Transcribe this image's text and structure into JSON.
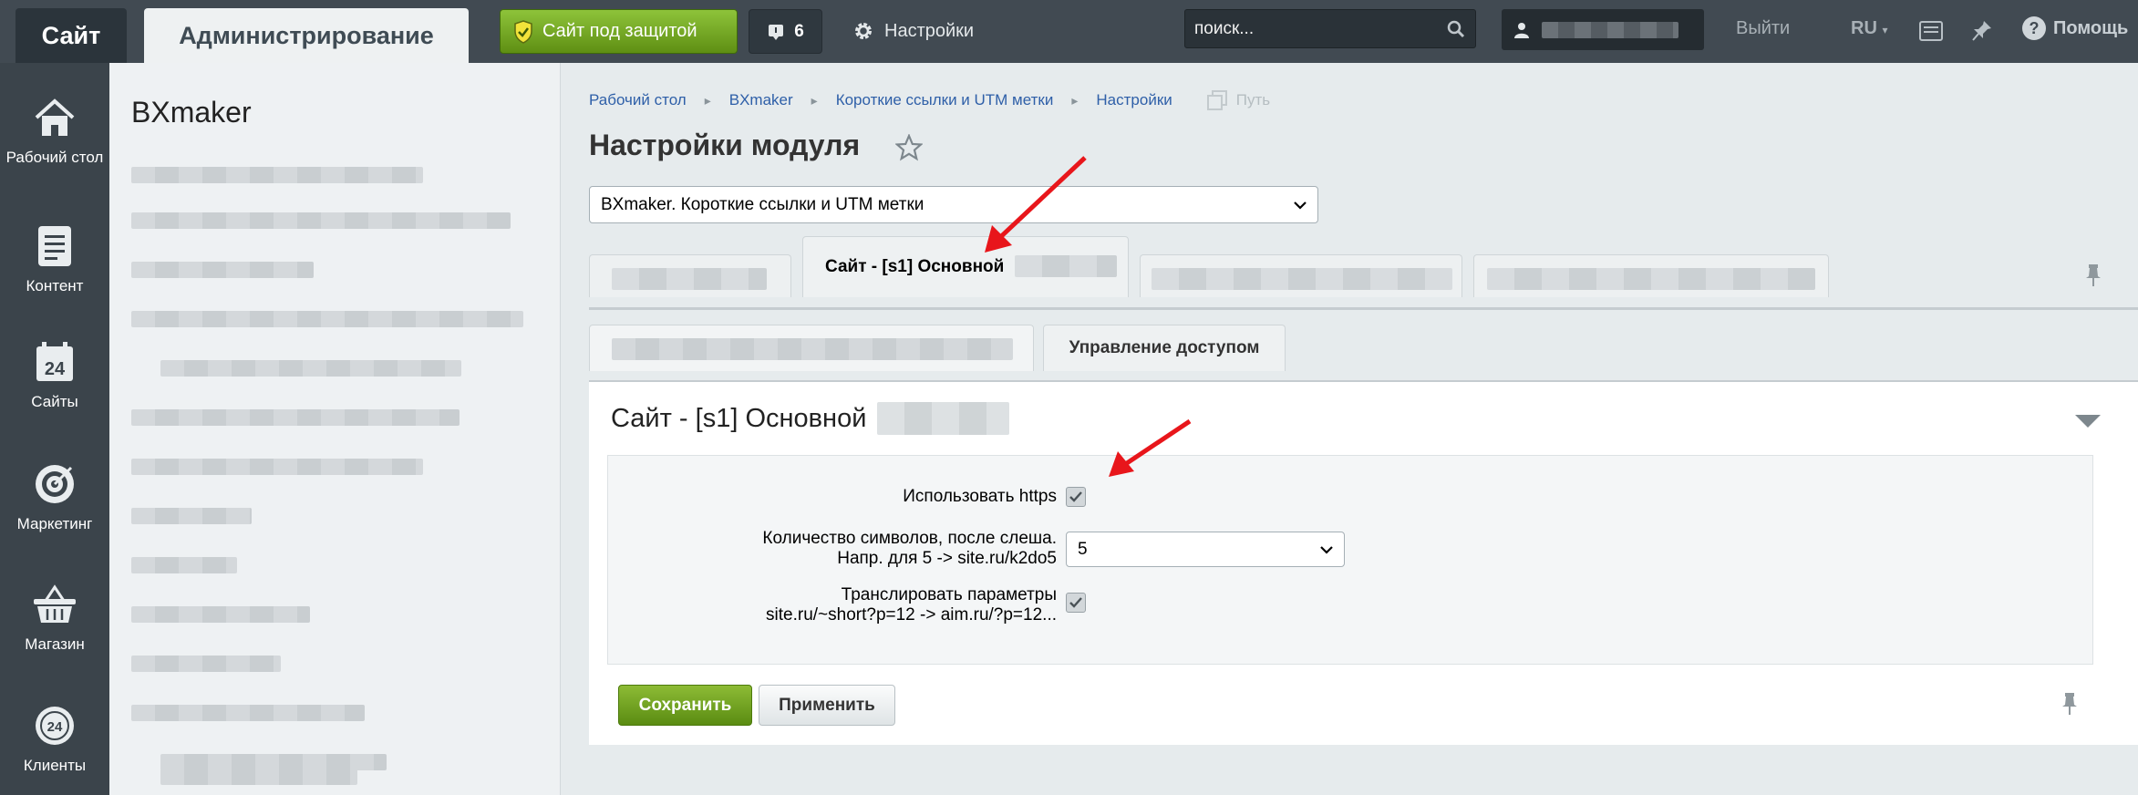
{
  "topbar": {
    "site_tab": "Сайт",
    "admin_tab": "Администрирование",
    "protect_button": "Сайт под защитой",
    "notifications_count": "6",
    "settings_link": "Настройки",
    "search_placeholder": "поиск...",
    "logout": "Выйти",
    "language": "RU",
    "help": "Помощь"
  },
  "leftmenu": {
    "items": [
      {
        "label": "Рабочий стол",
        "icon": "home-icon"
      },
      {
        "label": "Контент",
        "icon": "document-icon"
      },
      {
        "label": "Сайты",
        "icon": "calendar-24-icon"
      },
      {
        "label": "Маркетинг",
        "icon": "target-icon"
      },
      {
        "label": "Магазин",
        "icon": "basket-icon"
      },
      {
        "label": "Клиенты",
        "icon": "clients-24-icon"
      }
    ]
  },
  "subnav": {
    "title": "BXmaker"
  },
  "breadcrumb": {
    "items": [
      "Рабочий стол",
      "BXmaker",
      "Короткие ссылки и UTM метки",
      "Настройки"
    ],
    "path_label": "Путь"
  },
  "page": {
    "title": "Настройки модуля",
    "module_select": "BXmaker. Короткие ссылки и UTM метки"
  },
  "tabs": {
    "active_site_tab": "Сайт - [s1] Основной",
    "access_tab": "Управление доступом"
  },
  "panel": {
    "title": "Сайт - [s1] Основной",
    "fields": {
      "https_label": "Использовать https",
      "https_checked": true,
      "chars_label_line1": "Количество символов, после слеша.",
      "chars_label_line2": "Напр. для 5 -> site.ru/k2do5",
      "chars_value": "5",
      "translate_label_line1": "Транслировать параметры",
      "translate_label_line2": "site.ru/~short?p=12 -> aim.ru/?p=12...",
      "translate_checked": true
    },
    "save_button": "Сохранить",
    "apply_button": "Применить"
  },
  "colors": {
    "topbar": "#414a52",
    "leftmenu": "#3b444b",
    "accent_green": "#6ea120",
    "link_blue": "#2e5fa8",
    "arrow_red": "#e8161b"
  }
}
